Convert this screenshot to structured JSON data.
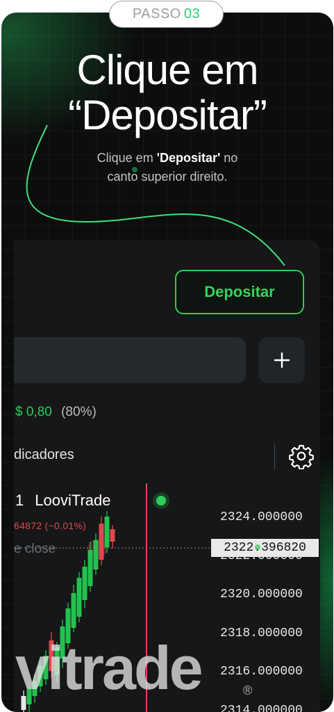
{
  "step": {
    "word": "PASSO",
    "number": "03"
  },
  "headline": {
    "line1": "Clique em",
    "line2": "“Depositar”"
  },
  "subtitle": {
    "pre": "Clique em ",
    "bold": "'Depositar'",
    "post": " no",
    "line2": "canto superior direito."
  },
  "panel": {
    "deposit_label": "Depositar",
    "plus_label": "+",
    "payout": {
      "amount": "$ 0,80",
      "percent": "(80%)"
    },
    "indicators_label": "dicadores"
  },
  "chart": {
    "symbol_prefix": "1",
    "symbol": "LooviTrade",
    "change": "64872 (−0.01%)",
    "close_label": "e close",
    "price_tag": "2322.396820",
    "y_ticks": [
      "2324.000000",
      "2322.000000",
      "2320.000000",
      "2318.000000",
      "2316.000000",
      "2314.000000"
    ],
    "watermark": "vitrade",
    "registered": "®"
  },
  "colors": {
    "accent": "#2dcd56",
    "negative": "#e0474f",
    "background": "#0c0e0d"
  },
  "icons": {
    "settings": "gear-icon",
    "add": "plus-icon",
    "live": "live-dot-icon"
  }
}
